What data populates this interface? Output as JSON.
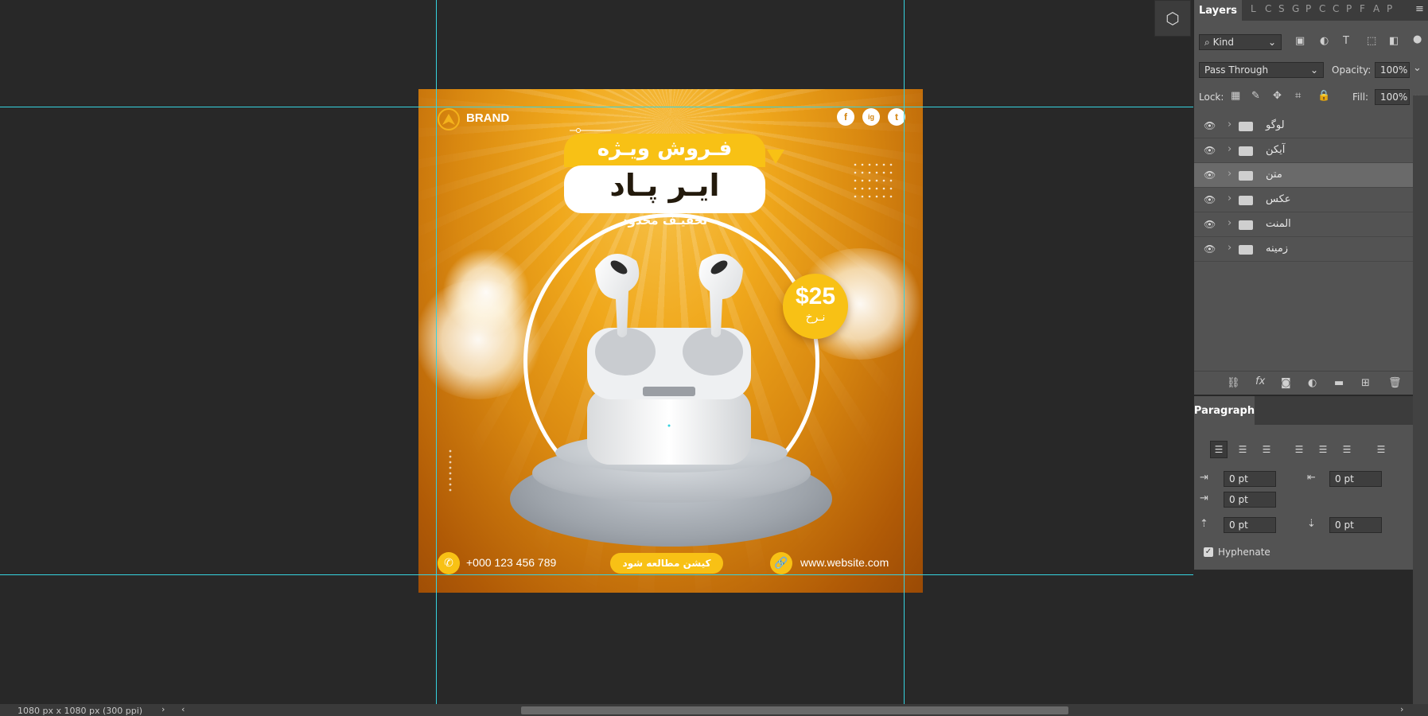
{
  "artboard": {
    "brand": "BRAND",
    "social": [
      "f",
      "ig",
      "t"
    ],
    "title_top": "فـروش ویـژه",
    "title_main": "ایـر پـاد",
    "subtitle": "تخفیـف محدود",
    "price": "$25",
    "price_label": "نـرخ",
    "phone": "+000 123 456 789",
    "cta": "کیشن مطالعه شود",
    "website": "www.website.com"
  },
  "layers_panel": {
    "active_tab": "Layers",
    "collapsed_tabs": [
      "L",
      "C",
      "S",
      "G",
      "P",
      "C",
      "C",
      "P",
      "F",
      "A",
      "P"
    ],
    "filter_kind": "Kind",
    "blend_mode": "Pass Through",
    "opacity_label": "Opacity:",
    "opacity_value": "100%",
    "lock_label": "Lock:",
    "fill_label": "Fill:",
    "fill_value": "100%",
    "layers": [
      {
        "name": "لوگو",
        "active": false
      },
      {
        "name": "آیکن",
        "active": false
      },
      {
        "name": "متن",
        "active": true
      },
      {
        "name": "عکس",
        "active": false
      },
      {
        "name": "المنت",
        "active": false
      },
      {
        "name": "زمینه",
        "active": false
      }
    ]
  },
  "paragraph_panel": {
    "title": "Paragraph",
    "indent_left": "0 pt",
    "indent_right": "0 pt",
    "indent_first": "0 pt",
    "space_before": "0 pt",
    "space_after": "0 pt",
    "hyphenate_label": "Hyphenate",
    "hyphenate_checked": true
  },
  "status": {
    "doc_info": "1080 px x 1080 px (300 ppi)"
  }
}
